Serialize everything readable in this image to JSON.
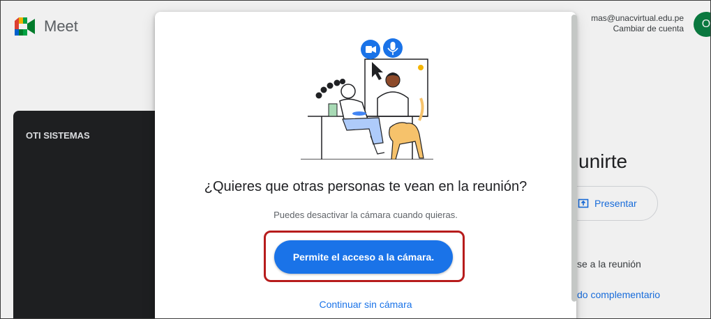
{
  "header": {
    "brand": "Meet",
    "account_email": "mas@unacvirtual.edu.pe",
    "switch_account": "Cambiar de cuenta",
    "avatar_initial": "O"
  },
  "preview": {
    "name": "OTI SISTEMAS"
  },
  "side": {
    "join_title": "unirte",
    "present_label": "Presentar",
    "other_options": "se a la reunión",
    "companion": "do complementario"
  },
  "dialog": {
    "title": "¿Quieres que otras personas te vean en la reunión?",
    "subtitle": "Puedes desactivar la cámara cuando quieras.",
    "allow_button": "Permite el acceso a la cámara.",
    "continue_link": "Continuar sin cámara"
  },
  "colors": {
    "accent": "#1a73e8",
    "highlight": "#b71c1c",
    "preview_bg": "#202124"
  },
  "icons": [
    "meet-logo-icon",
    "present-icon",
    "camera-icon",
    "microphone-icon",
    "cursor-icon"
  ]
}
